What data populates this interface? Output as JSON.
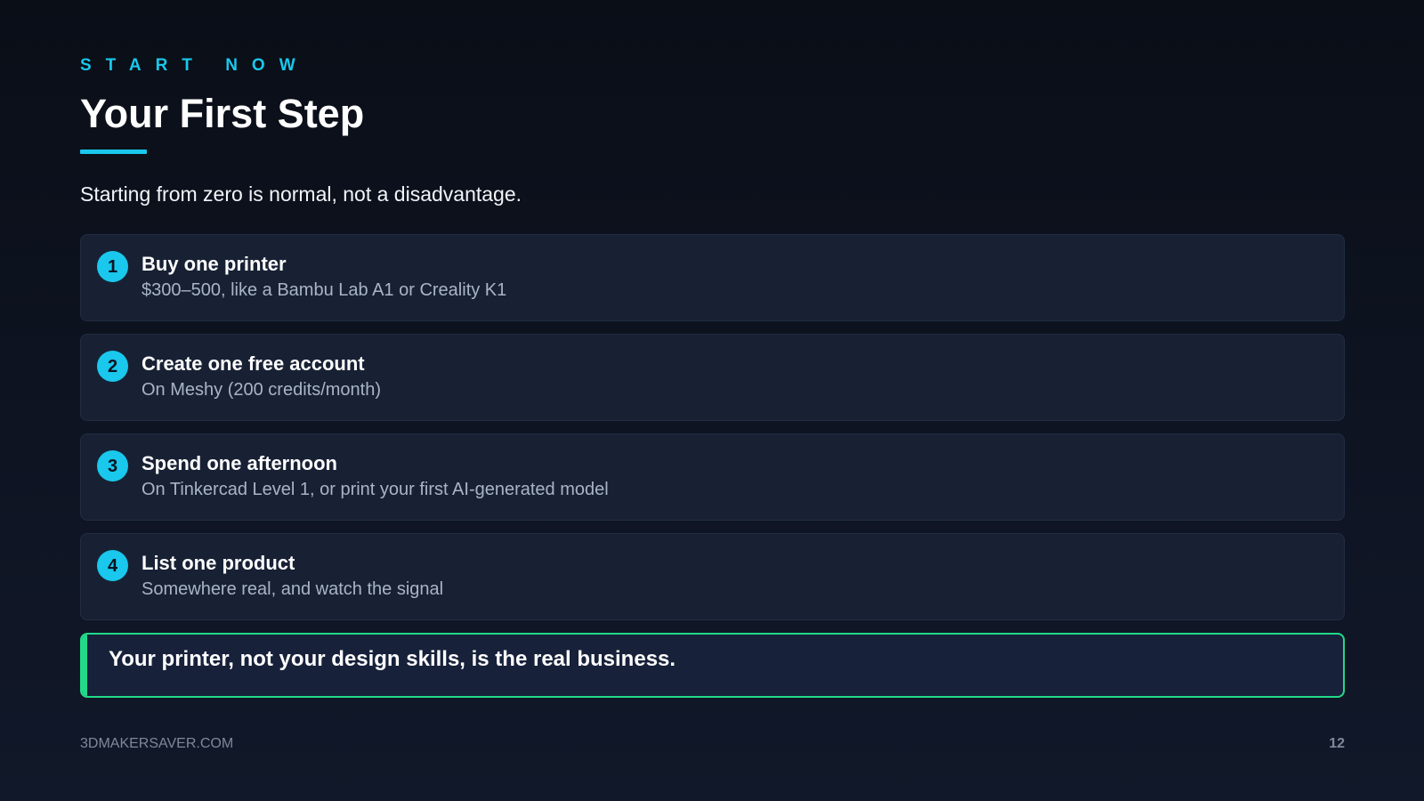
{
  "eyebrow": "START NOW",
  "title": "Your First Step",
  "subtitle": "Starting from zero is normal, not a disadvantage.",
  "steps": [
    {
      "number": "1",
      "title": "Buy one printer",
      "description": "$300–500, like a Bambu Lab A1 or Creality K1"
    },
    {
      "number": "2",
      "title": "Create one free account",
      "description": "On Meshy (200 credits/month)"
    },
    {
      "number": "3",
      "title": "Spend one afternoon",
      "description": "On Tinkercad Level 1, or print your first AI-generated model"
    },
    {
      "number": "4",
      "title": "List one product",
      "description": "Somewhere real, and watch the signal"
    }
  ],
  "callout": "Your printer, not your design skills, is the real business.",
  "footer": {
    "site": "3DMAKERSAVER.COM",
    "page_number": "12"
  },
  "colors": {
    "accent": "#19c8ec",
    "callout_accent": "#22d98a",
    "background": "#0c111d",
    "card": "#182134"
  }
}
